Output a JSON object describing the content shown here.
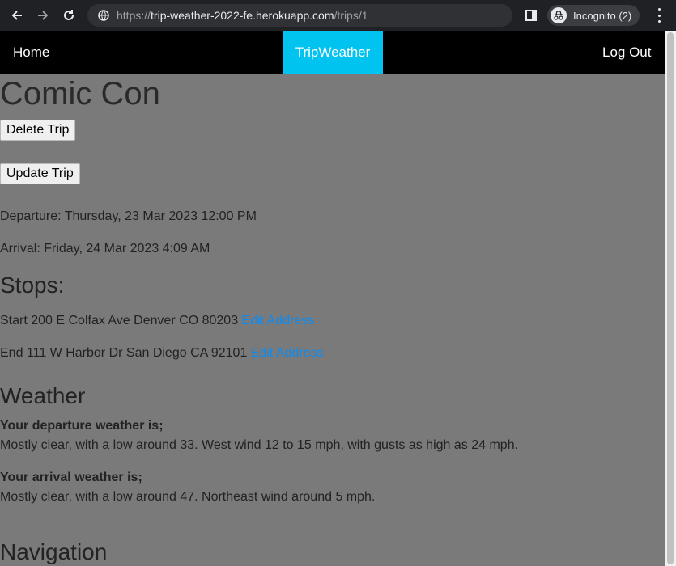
{
  "browser": {
    "url_scheme": "https://",
    "url_host": "trip-weather-2022-fe.herokuapp.com",
    "url_path": "/trips/1",
    "incognito_label": "Incognito (2)"
  },
  "nav": {
    "home": "Home",
    "brand": "TripWeather",
    "logout": "Log Out"
  },
  "trip": {
    "title": "Comic Con",
    "delete_label": "Delete Trip",
    "update_label": "Update Trip",
    "departure": "Departure: Thursday, 23 Mar 2023 12:00 PM",
    "arrival": "Arrival: Friday, 24 Mar 2023 4:09 AM"
  },
  "stops": {
    "heading": "Stops:",
    "start_text": "Start 200 E Colfax Ave Denver CO 80203",
    "start_link": "Edit Address",
    "end_text": "End 111 W Harbor Dr San Diego CA 92101",
    "end_link": "Edit Address"
  },
  "weather": {
    "heading": "Weather",
    "departure_label": "Your departure weather is;",
    "departure_forecast": "Mostly clear, with a low around 33. West wind 12 to 15 mph, with gusts as high as 24 mph.",
    "arrival_label": "Your arrival weather is;",
    "arrival_forecast": "Mostly clear, with a low around 47. Northeast wind around 5 mph."
  },
  "navigation": {
    "heading": "Navigation"
  }
}
